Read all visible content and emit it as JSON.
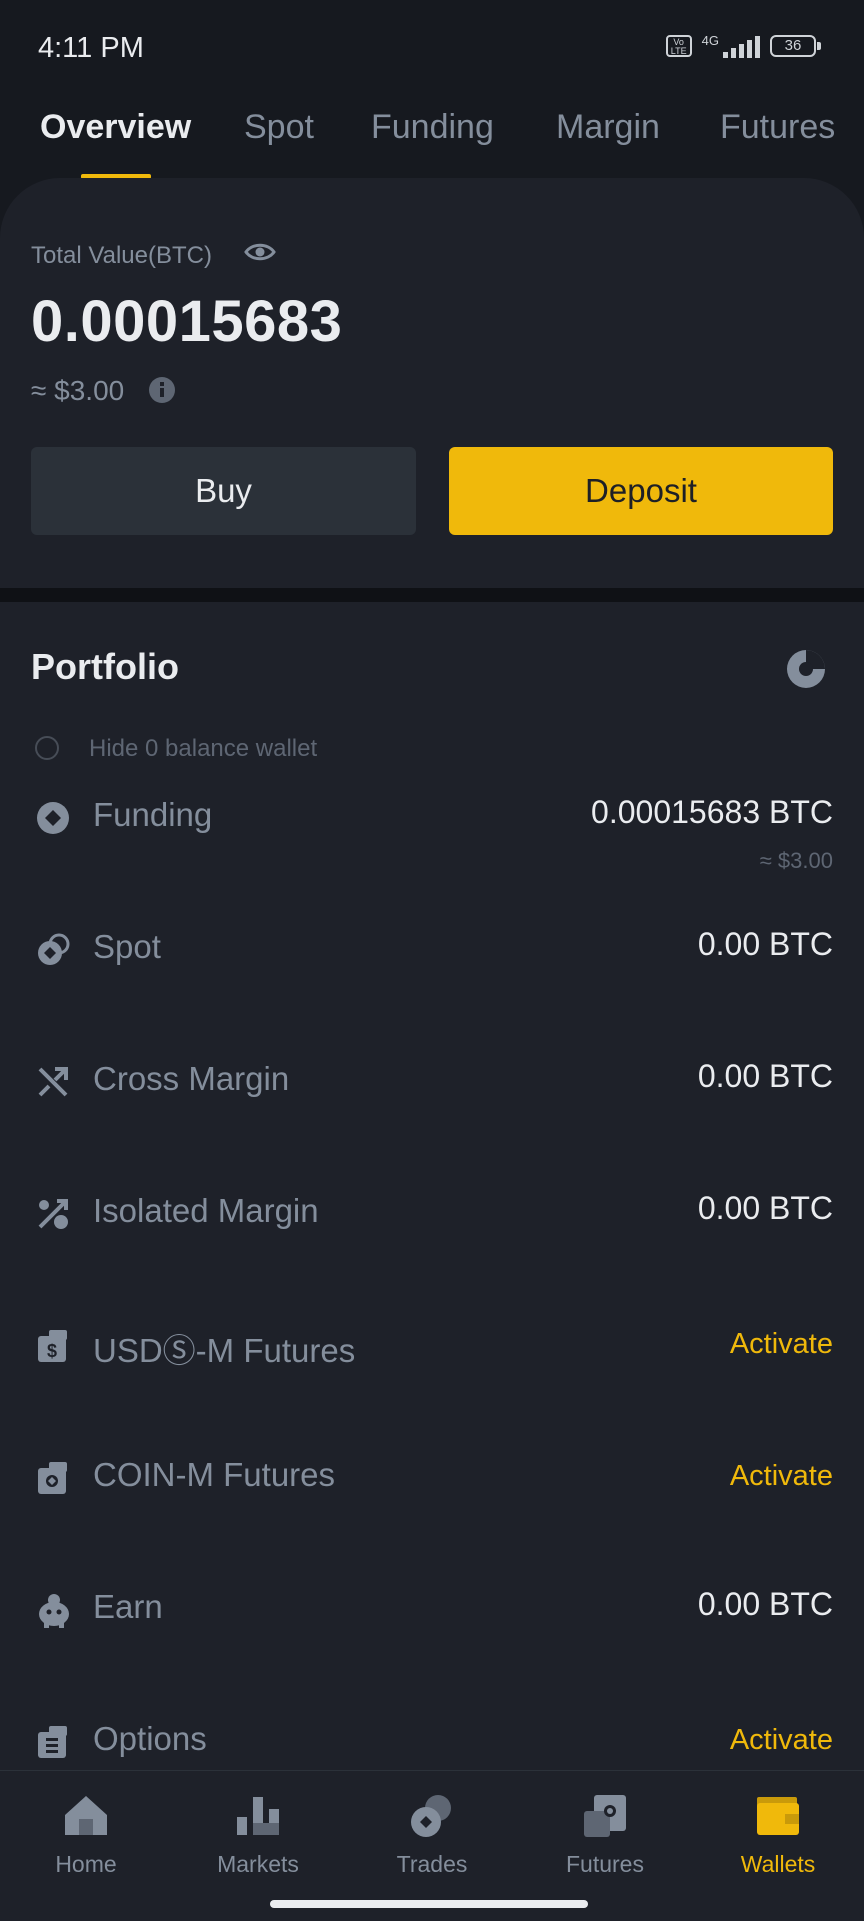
{
  "status_bar": {
    "time": "4:11 PM",
    "network_label": "4G",
    "volte_label": "Vo\nLTE",
    "battery": "36"
  },
  "tabs": [
    {
      "label": "Overview",
      "active": true
    },
    {
      "label": "Spot",
      "active": false
    },
    {
      "label": "Funding",
      "active": false
    },
    {
      "label": "Margin",
      "active": false
    },
    {
      "label": "Futures",
      "active": false
    }
  ],
  "overview": {
    "total_label": "Total Value(BTC)",
    "total_value": "0.00015683",
    "approx_usd": "≈ $3.00",
    "buy_label": "Buy",
    "deposit_label": "Deposit"
  },
  "portfolio": {
    "title": "Portfolio",
    "hide_zero_label": "Hide 0 balance wallet",
    "rows": [
      {
        "icon": "funding-icon",
        "label": "Funding",
        "value": "0.00015683 BTC",
        "sub": "≈ $3.00",
        "activate": false
      },
      {
        "icon": "spot-icon",
        "label": "Spot",
        "value": "0.00 BTC",
        "sub": "",
        "activate": false
      },
      {
        "icon": "cross-margin-icon",
        "label": "Cross Margin",
        "value": "0.00 BTC",
        "sub": "",
        "activate": false
      },
      {
        "icon": "isolated-margin-icon",
        "label": "Isolated Margin",
        "value": "0.00 BTC",
        "sub": "",
        "activate": false
      },
      {
        "icon": "usds-futures-icon",
        "label": "USDⓈ-M Futures",
        "value": "Activate",
        "sub": "",
        "activate": true
      },
      {
        "icon": "coin-futures-icon",
        "label": "COIN-M Futures",
        "value": "Activate",
        "sub": "",
        "activate": true
      },
      {
        "icon": "earn-icon",
        "label": "Earn",
        "value": "0.00 BTC",
        "sub": "",
        "activate": false
      },
      {
        "icon": "options-icon",
        "label": "Options",
        "value": "Activate",
        "sub": "",
        "activate": true
      }
    ]
  },
  "bottom_nav": [
    {
      "label": "Home",
      "icon": "home-icon",
      "active": false
    },
    {
      "label": "Markets",
      "icon": "markets-icon",
      "active": false
    },
    {
      "label": "Trades",
      "icon": "trades-icon",
      "active": false
    },
    {
      "label": "Futures",
      "icon": "futures-icon",
      "active": false
    },
    {
      "label": "Wallets",
      "icon": "wallets-icon",
      "active": true
    }
  ],
  "colors": {
    "background": "#16191f",
    "card": "#1e2129",
    "accent": "#f0b90b",
    "text_primary": "#eaecef",
    "text_secondary": "#848e9c"
  }
}
